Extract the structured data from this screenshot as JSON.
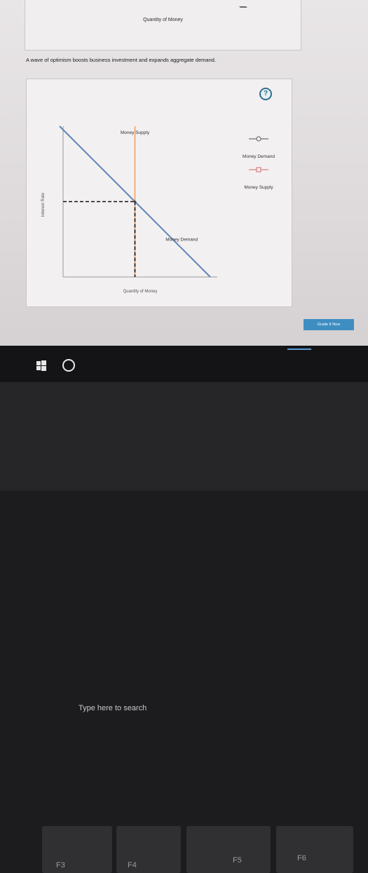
{
  "previous_graph": {
    "xlabel": "Quantity of Money"
  },
  "question": {
    "text": "A wave of optimism boosts business investment and expands aggregate demand."
  },
  "graph_panel": {
    "help_label": "?"
  },
  "chart_data": {
    "type": "line",
    "xlabel": "Quantity of Money",
    "ylabel": "Interest Rate",
    "series": [
      {
        "name": "Money Demand",
        "label": "Money Demand",
        "color": "#5b86b6",
        "points": [
          [
            0,
            1.0
          ],
          [
            1.0,
            0
          ]
        ]
      },
      {
        "name": "Money Supply",
        "label": "Money Supply",
        "color": "#f0a05a",
        "points": [
          [
            0.5,
            1.0
          ],
          [
            0.5,
            0
          ]
        ]
      }
    ],
    "equilibrium": {
      "x": 0.5,
      "y": 0.5
    },
    "legend": [
      {
        "label": "Money Demand",
        "marker": "circle",
        "color": "#6f6f6f"
      },
      {
        "label": "Money Supply",
        "marker": "square",
        "color": "#d87f7f"
      }
    ],
    "legend_position": "top-right",
    "grid": false
  },
  "actions": {
    "grade_label": "Grade It Now"
  },
  "taskbar": {
    "search_placeholder": "Type here to search",
    "icons": [
      "windows-icon",
      "cortana-icon",
      "microphone-icon",
      "task-view-icon",
      "edge-icon",
      "store-icon",
      "file-explorer-icon"
    ]
  },
  "keyboard": {
    "keys": [
      "F3",
      "F4",
      "F5",
      "F6"
    ]
  }
}
